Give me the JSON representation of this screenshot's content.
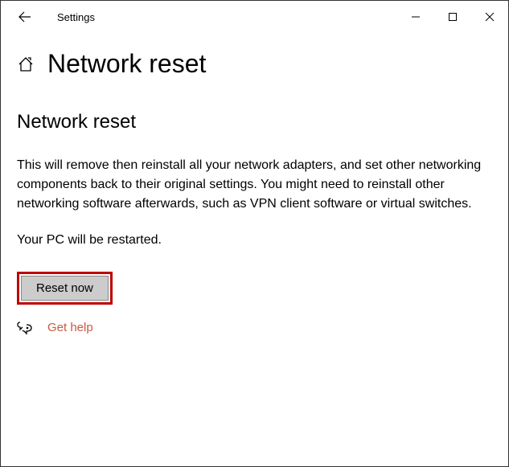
{
  "titlebar": {
    "app_title": "Settings"
  },
  "header": {
    "page_title": "Network reset"
  },
  "content": {
    "section_heading": "Network reset",
    "description": "This will remove then reinstall all your network adapters, and set other networking components back to their original settings. You might need to reinstall other networking software afterwards, such as VPN client software or virtual switches.",
    "restart_note": "Your PC will be restarted.",
    "reset_button_label": "Reset now",
    "help_link_label": "Get help"
  }
}
